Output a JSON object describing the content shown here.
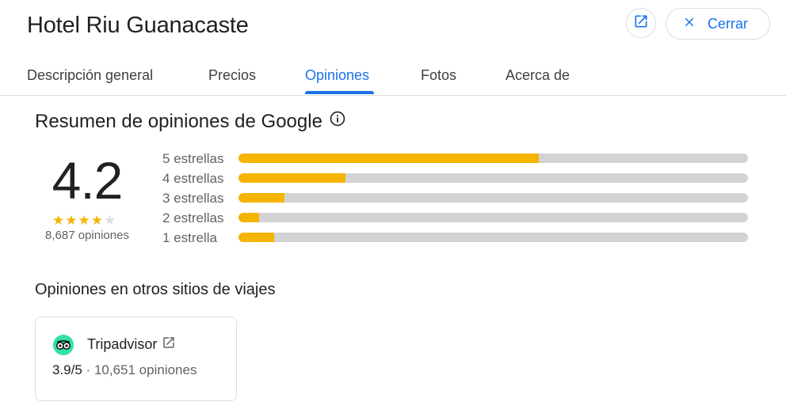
{
  "header": {
    "title": "Hotel Riu Guanacaste",
    "open_icon": "open-in-new-icon",
    "close_label": "Cerrar",
    "close_icon": "close-icon"
  },
  "tabs": [
    {
      "label": "Descripción general",
      "active": false
    },
    {
      "label": "Precios",
      "active": false
    },
    {
      "label": "Opiniones",
      "active": true
    },
    {
      "label": "Fotos",
      "active": false
    },
    {
      "label": "Acerca de",
      "active": false
    }
  ],
  "summary": {
    "title": "Resumen de opiniones de Google",
    "info_icon": "info-icon",
    "rating": "4.2",
    "stars_filled": 4,
    "stars_total": 5,
    "count_text": "8,687 opiniones",
    "rows": [
      {
        "label": "5 estrellas",
        "fraction": 0.59
      },
      {
        "label": "4 estrellas",
        "fraction": 0.21
      },
      {
        "label": "3 estrellas",
        "fraction": 0.09
      },
      {
        "label": "2 estrellas",
        "fraction": 0.04
      },
      {
        "label": "1 estrella",
        "fraction": 0.07
      }
    ]
  },
  "other_sites": {
    "title": "Opiniones en otros sitios de viajes",
    "cards": [
      {
        "name": "Tripadvisor",
        "logo_icon": "tripadvisor-owl-icon",
        "link_icon": "open-in-new-icon",
        "rating": "3.9/5",
        "separator": "·",
        "count": "10,651 opiniones"
      }
    ]
  },
  "colors": {
    "accent": "#1a73e8",
    "bar_fill": "#f4b400",
    "bar_track": "#d3d3d3",
    "star_filled": "#f4b400",
    "star_empty": "#dadce0",
    "tripadvisor": "#34e0a1"
  }
}
